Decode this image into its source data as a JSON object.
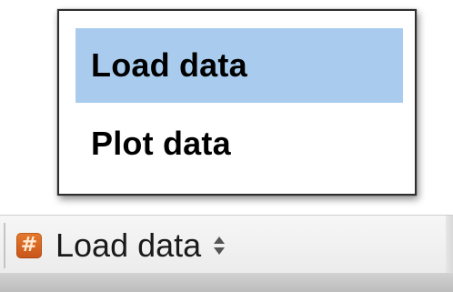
{
  "menu": {
    "items": [
      {
        "label": "Load data",
        "selected": true
      },
      {
        "label": "Plot data",
        "selected": false
      }
    ],
    "selection_color": "#a9ccee"
  },
  "toolbar": {
    "popup": {
      "icon": "hash-icon",
      "icon_glyph": "#",
      "icon_color": "#d9661f",
      "selected_value": "Load data",
      "indicator_icon": "up-down-arrows-icon"
    }
  }
}
